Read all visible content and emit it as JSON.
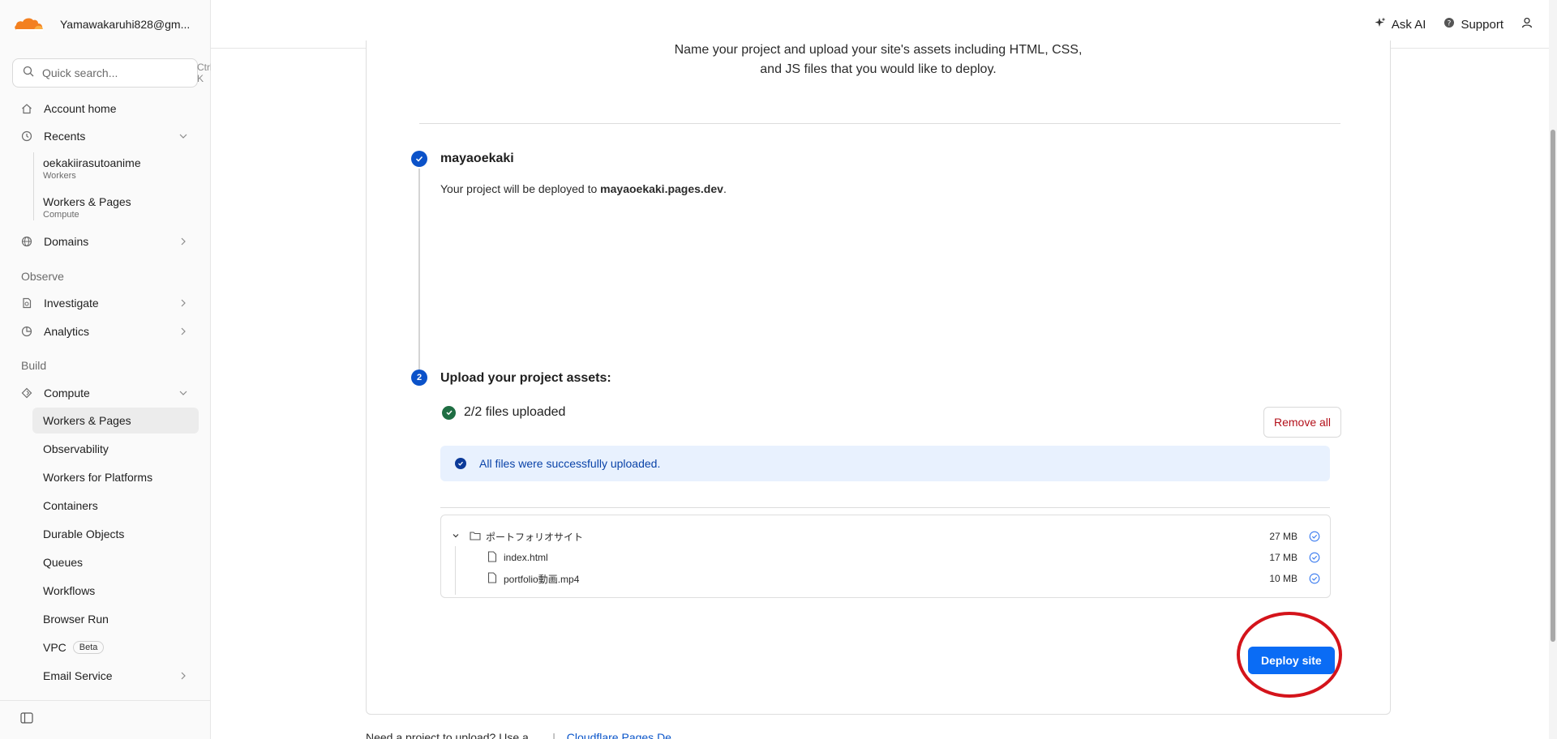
{
  "account": {
    "name": "Yamawakaruhi828@gm..."
  },
  "search": {
    "placeholder": "Quick search...",
    "shortcut": "Ctrl K"
  },
  "nav": {
    "account_home": "Account home",
    "recents": "Recents",
    "recent_items": [
      {
        "title": "oekakiirasutoanime",
        "sub": "Workers"
      },
      {
        "title": "Workers & Pages",
        "sub": "Compute"
      }
    ],
    "domains": "Domains",
    "observe_label": "Observe",
    "investigate": "Investigate",
    "analytics": "Analytics",
    "build_label": "Build",
    "compute": "Compute",
    "compute_items": [
      "Workers & Pages",
      "Observability",
      "Workers for Platforms",
      "Containers",
      "Durable Objects",
      "Queues",
      "Workflows",
      "Browser Run",
      "VPC",
      "Email Service"
    ],
    "beta": "Beta"
  },
  "topbar": {
    "ask_ai": "Ask AI",
    "support": "Support"
  },
  "main": {
    "intro_line1": "Name your project and upload your site's assets including HTML, CSS,",
    "intro_line2": "and JS files that you would like to deploy.",
    "step1": {
      "title": "mayaoekaki",
      "desc_prefix": "Your project will be deployed to ",
      "domain": "mayaoekaki.pages.dev",
      "desc_suffix": "."
    },
    "step2": {
      "number": "2",
      "title": "Upload your project assets:",
      "uploaded": "2/2 files uploaded",
      "remove_all": "Remove all",
      "banner": "All files were successfully uploaded.",
      "files": [
        {
          "name": "ポートフォリオサイト",
          "size": "27 MB",
          "type": "folder"
        },
        {
          "name": "index.html",
          "size": "17 MB",
          "type": "file"
        },
        {
          "name": "portfolio動画.mp4",
          "size": "10 MB",
          "type": "file"
        }
      ]
    },
    "deploy": "Deploy site",
    "footer_text": "Need a project to upload? Use a ...",
    "footer_link": "Cloudflare Pages De..."
  },
  "colors": {
    "brand_orange": "#f38020",
    "primary": "#0a6cf5",
    "danger": "#b3101a",
    "step": "#0b52c9",
    "annotation": "#d4141b"
  }
}
